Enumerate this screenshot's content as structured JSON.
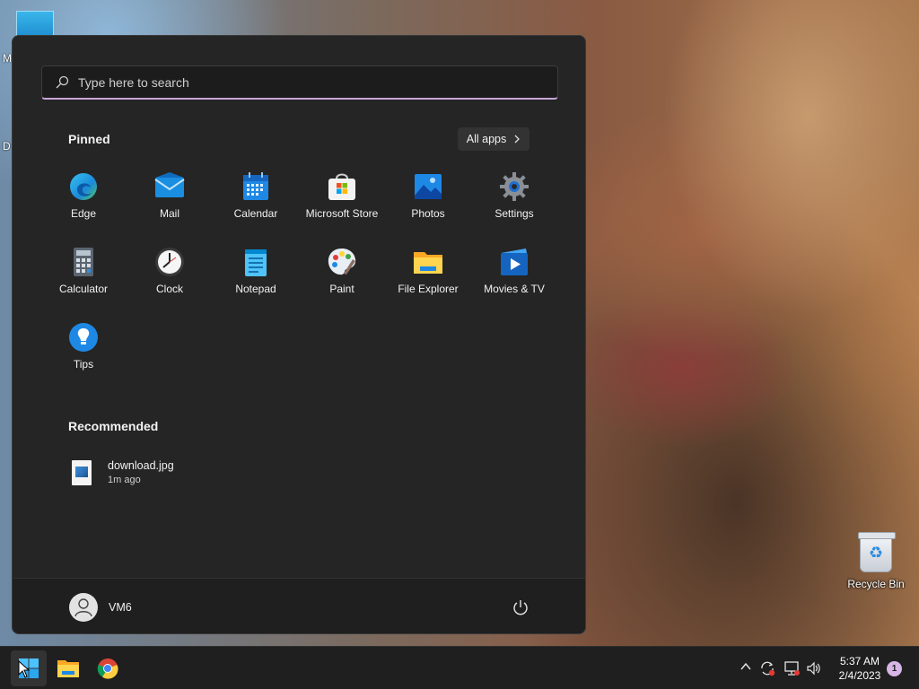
{
  "desktop": {
    "recycle_bin_label": "Recycle Bin",
    "partial_labels": [
      "M",
      "D"
    ]
  },
  "start_menu": {
    "search_placeholder": "Type here to search",
    "pinned_title": "Pinned",
    "all_apps_label": "All apps",
    "pinned_apps": [
      {
        "label": "Edge",
        "icon": "edge-icon"
      },
      {
        "label": "Mail",
        "icon": "mail-icon"
      },
      {
        "label": "Calendar",
        "icon": "calendar-icon"
      },
      {
        "label": "Microsoft Store",
        "icon": "store-icon"
      },
      {
        "label": "Photos",
        "icon": "photos-icon"
      },
      {
        "label": "Settings",
        "icon": "gear-icon"
      },
      {
        "label": "Calculator",
        "icon": "calculator-icon"
      },
      {
        "label": "Clock",
        "icon": "clock-icon"
      },
      {
        "label": "Notepad",
        "icon": "notepad-icon"
      },
      {
        "label": "Paint",
        "icon": "paint-icon"
      },
      {
        "label": "File Explorer",
        "icon": "folder-icon"
      },
      {
        "label": "Movies & TV",
        "icon": "movies-icon"
      },
      {
        "label": "Tips",
        "icon": "lightbulb-icon"
      }
    ],
    "recommended_title": "Recommended",
    "recommended": [
      {
        "name": "download.jpg",
        "time": "1m ago",
        "icon": "image-file-icon"
      }
    ],
    "user_name": "VM6"
  },
  "taskbar": {
    "apps": [
      "windows-start-icon",
      "file-explorer-icon",
      "chrome-icon"
    ],
    "time": "5:37 AM",
    "date": "2/4/2023",
    "notification_count": "1"
  },
  "colors": {
    "menu_bg": "#252525",
    "footer_bg": "#1f1f1f",
    "accent": "#c9a5d8",
    "taskbar_bg": "#1f1f1f"
  }
}
